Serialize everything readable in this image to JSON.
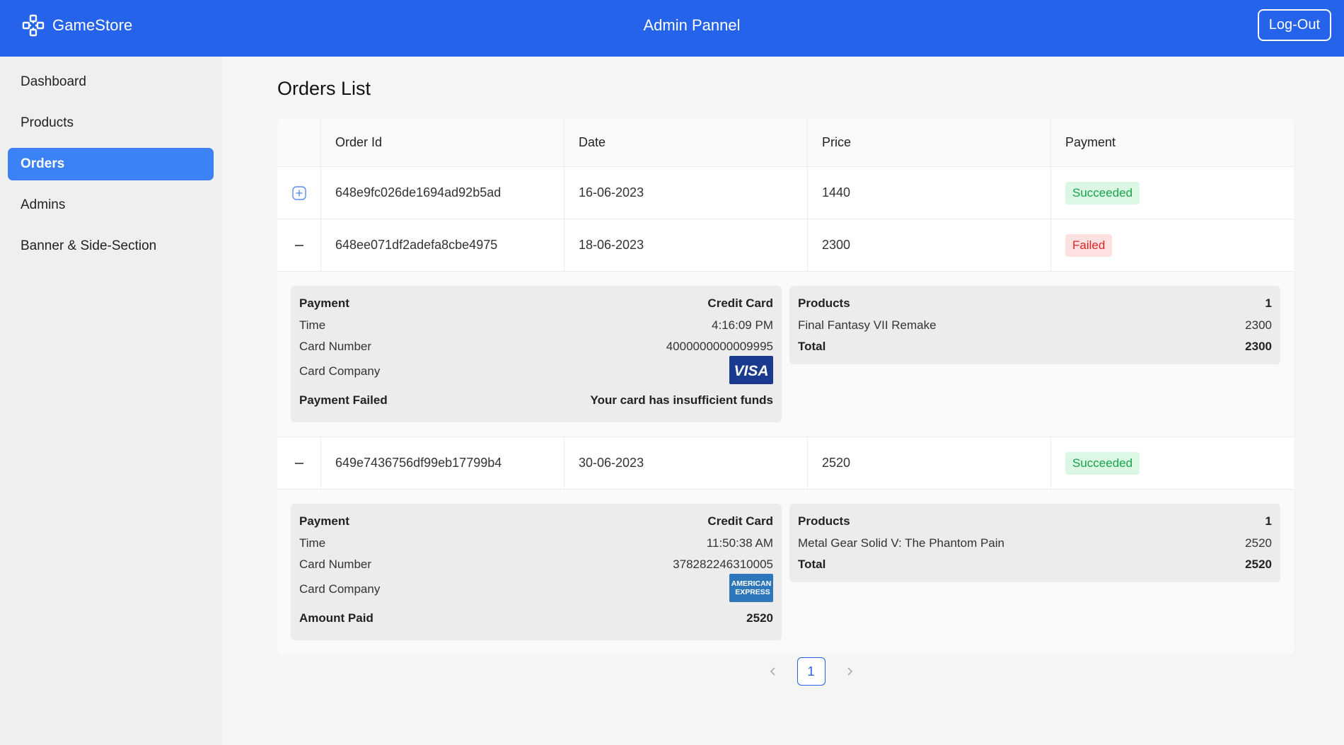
{
  "header": {
    "brand": "GameStore",
    "title": "Admin Pannel",
    "logout_label": "Log-Out",
    "color": "#2563eb"
  },
  "sidebar": {
    "items": [
      {
        "label": "Dashboard"
      },
      {
        "label": "Products"
      },
      {
        "label": "Orders",
        "active": true
      },
      {
        "label": "Admins"
      },
      {
        "label": "Banner & Side-Section"
      }
    ]
  },
  "main": {
    "title": "Orders List",
    "table": {
      "columns": [
        "Order Id",
        "Date",
        "Price",
        "Payment"
      ],
      "rows": [
        {
          "order_id": "648e9fc026de1694ad92b5ad",
          "date": "16-06-2023",
          "price": "1440",
          "status": "Succeeded",
          "expanded": false
        },
        {
          "order_id": "648ee071df2adefa8cbe4975",
          "date": "18-06-2023",
          "price": "2300",
          "status": "Failed",
          "expanded": true,
          "details": {
            "payment_label": "Payment",
            "payment_value": "Credit Card",
            "time_label": "Time",
            "time_value": "4:16:09 PM",
            "card_number_label": "Card Number",
            "card_number_value": "4000000000009995",
            "card_company_label": "Card Company",
            "card_company_logo": "VISA",
            "result_label": "Payment Failed",
            "result_value": "Your card has insufficient funds",
            "products_label": "Products",
            "products_count": "1",
            "product_name": "Final Fantasy VII Remake",
            "product_price": "2300",
            "total_label": "Total",
            "total_value": "2300"
          }
        },
        {
          "order_id": "649e7436756df99eb17799b4",
          "date": "30-06-2023",
          "price": "2520",
          "status": "Succeeded",
          "expanded": true,
          "details": {
            "payment_label": "Payment",
            "payment_value": "Credit Card",
            "time_label": "Time",
            "time_value": "11:50:38 AM",
            "card_number_label": "Card Number",
            "card_number_value": "378282246310005",
            "card_company_label": "Card Company",
            "card_company_logo_line1": "AMERICAN",
            "card_company_logo_line2": "EXPRESS",
            "result_label": "Amount Paid",
            "result_value": "2520",
            "products_label": "Products",
            "products_count": "1",
            "product_name": "Metal Gear Solid V: The Phantom Pain",
            "product_price": "2520",
            "total_label": "Total",
            "total_value": "2520"
          }
        }
      ]
    },
    "pagination": {
      "current_page": "1",
      "prev_icon": "chevron-left-icon",
      "next_icon": "chevron-right-icon"
    }
  },
  "colors": {
    "success_text": "#16a34a",
    "success_bg": "#dcf7e4",
    "failed_text": "#dc2626",
    "failed_bg": "#fde0e0",
    "visa": "#1a3a8f",
    "amex": "#2e77bb"
  }
}
